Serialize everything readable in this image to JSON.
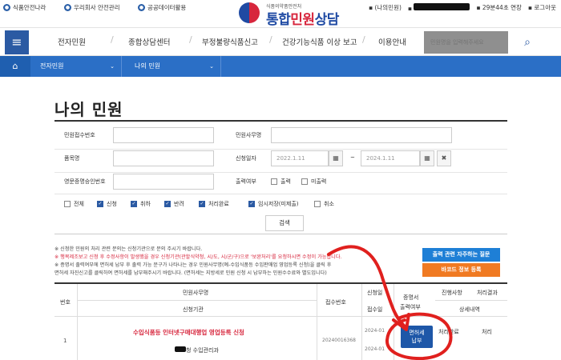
{
  "topbar": {
    "links": [
      "식품안전나라",
      "우리회사 안전관리",
      "공공데이터활용"
    ],
    "logo_sub": "식품의약품안전처",
    "logo_main_blue": "통합",
    "logo_main_red": "민원",
    "logo_main_blue2": "상담",
    "my_complaint": "(나의민원)",
    "session": "29분44초 연장",
    "logout": "로그아웃"
  },
  "nav": {
    "items": [
      "전자민원",
      "종합상담센터",
      "부정불량식품신고",
      "건강기능식품 이상 보고",
      "이용안내"
    ],
    "search_placeholder": "민원명을 입력해주세요"
  },
  "breadcrumb": {
    "level1": "전자민원",
    "level2": "나의 민원"
  },
  "page_title": "나의 민원",
  "form": {
    "receipt_no_label": "민원접수번호",
    "office_label": "민원사무명",
    "product_label": "품목명",
    "apply_date_label": "신청일자",
    "date_from": "2022.1.11",
    "date_sep": "~",
    "date_to": "2024.1.11",
    "cert_label": "영문증명승인번호",
    "print_label": "출력여부",
    "print_opts": [
      "출력",
      "미출력"
    ],
    "status_opts": [
      {
        "label": "전체",
        "checked": false
      },
      {
        "label": "신청",
        "checked": true
      },
      {
        "label": "취하",
        "checked": true
      },
      {
        "label": "반려",
        "checked": true
      },
      {
        "label": "처리완료",
        "checked": true
      },
      {
        "label": "임시저장(미제출)",
        "checked": true
      },
      {
        "label": "취소",
        "checked": false
      }
    ],
    "search_button": "검색"
  },
  "notes": {
    "line1": "※ 신청한 민원의 처리 관련 문의는 신청기관으로 문의 주시기 바랍니다.",
    "line2": "※ 행목제조보고 신청 후 수정사항이 발생했을 경우 신청기관(관할식약청, 시/도, 시/군/구)으로 '보완처리'를 요청하시면 수정이 가능합니다.",
    "line3": "※ 증명서 출력여부에 면허세 납부 후 출력 가능 문구가 나타나는 경우 민원사무명(예-수입식품등 수입판매업 영업등록 신청)을 클릭 후",
    "line4": "면허세 자진신고를 클릭하여 면허세를 납부해주시기 바랍니다. (면허세는 지방세로 민원 신청 시 납부하는 민원수수료와 별도입니다)",
    "faq_button": "출력 관련 자주하는 질문",
    "barcode_button": "바코드 정보 등록"
  },
  "table": {
    "headers": {
      "no": "번호",
      "office": "민원사무명",
      "agency": "신청기관",
      "receipt": "접수번호",
      "apply_date": "신청일",
      "receipt_date": "접수일",
      "cert": "증명서",
      "cert2": "출력여부",
      "progress": "진행사항",
      "result": "처리결과",
      "detail": "상세내역"
    },
    "row": {
      "no": "1",
      "office": "수입식품등 인터넷구매대행업 영업등록 신청",
      "agency": "청 수입관리과",
      "receipt": "20240016368",
      "apply_date": "2024-01",
      "receipt_date": "2024-01",
      "progress": "처리완료",
      "result": "처리",
      "pay_button_line1": "면허세",
      "pay_button_line2": "납부"
    }
  },
  "colors": {
    "accent": "#2b5aa3",
    "breadcrumb": "#2b6fc6",
    "warning": "#d7263d",
    "orange": "#f07a22",
    "blue_btn": "#1e7fd6"
  }
}
